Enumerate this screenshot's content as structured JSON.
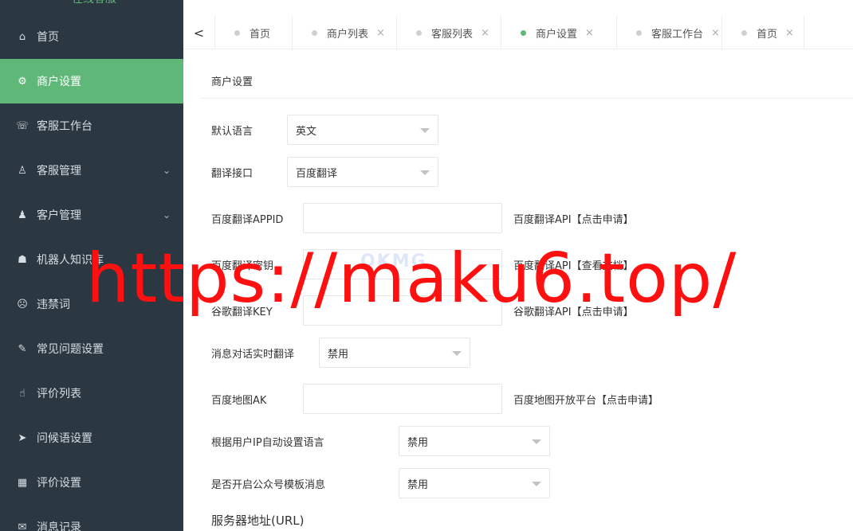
{
  "sidebar": {
    "brand": "在线客服",
    "items": [
      {
        "label": "首页",
        "icon": "home-icon",
        "glyph": "⌂"
      },
      {
        "label": "商户设置",
        "icon": "gear-icon",
        "glyph": "⚙"
      },
      {
        "label": "客服工作台",
        "icon": "headset-icon",
        "glyph": "☏"
      },
      {
        "label": "客服管理",
        "icon": "user-icon",
        "glyph": "♙"
      },
      {
        "label": "客户管理",
        "icon": "users-icon",
        "glyph": "♟"
      },
      {
        "label": "机器人知识库",
        "icon": "robot-icon",
        "glyph": "☗"
      },
      {
        "label": "违禁词",
        "icon": "face-icon",
        "glyph": "☹"
      },
      {
        "label": "常见问题设置",
        "icon": "edit-icon",
        "glyph": "✎"
      },
      {
        "label": "评价列表",
        "icon": "thumb-icon",
        "glyph": "☝"
      },
      {
        "label": "问候语设置",
        "icon": "send-icon",
        "glyph": "➤"
      },
      {
        "label": "评价设置",
        "icon": "calendar-icon",
        "glyph": "▦"
      },
      {
        "label": "消息记录",
        "icon": "message-icon",
        "glyph": "✉"
      }
    ],
    "expand_glyph": "⌄"
  },
  "tabs": {
    "back_glyph": "<",
    "close_glyph": "×",
    "items": [
      {
        "label": "首页",
        "closable": false,
        "active": false
      },
      {
        "label": "商户列表",
        "closable": true,
        "active": false
      },
      {
        "label": "客服列表",
        "closable": true,
        "active": false
      },
      {
        "label": "商户设置",
        "closable": true,
        "active": true
      },
      {
        "label": "客服工作台",
        "closable": true,
        "active": false
      },
      {
        "label": "首页",
        "closable": true,
        "active": false
      }
    ]
  },
  "form": {
    "title": "商户设置",
    "default_language": {
      "label": "默认语言",
      "value": "英文"
    },
    "translate_api": {
      "label": "翻译接口",
      "value": "百度翻译"
    },
    "baidu_appid": {
      "label": "百度翻译APPID",
      "value": "",
      "help": "百度翻译API【点击申请】"
    },
    "baidu_secret": {
      "label": "百度翻译密钥",
      "value": "",
      "help": "百度翻译API【查看文档】"
    },
    "google_key": {
      "label": "谷歌翻译KEY",
      "value": "",
      "help": "谷歌翻译API【点击申请】"
    },
    "realtime_translate": {
      "label": "消息对话实时翻译",
      "value": "禁用"
    },
    "baidu_map_ak": {
      "label": "百度地图AK",
      "value": "",
      "help": "百度地图开放平台【点击申请】"
    },
    "ip_language": {
      "label": "根据用户IP自动设置语言",
      "value": "禁用"
    },
    "template_msg": {
      "label": "是否开启公众号模板消息",
      "value": "禁用"
    },
    "server_url_title": "服务器地址(URL)"
  },
  "watermark": {
    "logo": "OKMG",
    "overlay": "https://maku6.top/"
  },
  "colors": {
    "sidebar_bg": "#2b3842",
    "accent": "#5fb878",
    "overlay": "#ff1010"
  }
}
